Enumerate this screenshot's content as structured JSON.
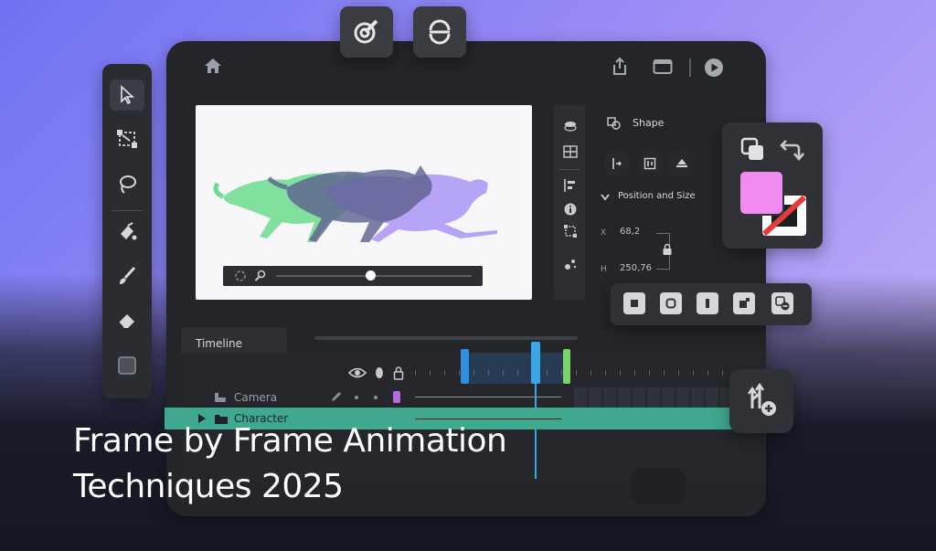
{
  "headline": {
    "line1": "Frame by Frame Animation",
    "line2": "Techniques 2025"
  },
  "icons": {
    "top_float_1": "target-pencil-icon",
    "top_float_2": "sync-icon",
    "home": "home-icon",
    "share": "share-icon",
    "window": "window-icon",
    "play": "play-icon",
    "tools": [
      "select-arrow-icon",
      "transform-icon",
      "lasso-icon",
      "paint-bucket-icon",
      "brush-icon",
      "eraser-icon",
      "color-swatch-icon"
    ]
  },
  "properties": {
    "section_title": "Shape",
    "subsection_title": "Position and Size",
    "x_label": "X",
    "x_value": "68,2",
    "y_label": "H",
    "y_value": "250,76"
  },
  "timeline": {
    "title": "Timeline",
    "layers": [
      {
        "name": "Camera"
      },
      {
        "name": "Character"
      }
    ]
  },
  "colors": {
    "accent_pink": "#f08cf0",
    "accent_blue": "#2e8fe0",
    "accent_green": "#7bd36a",
    "cat_green": "#68d88a",
    "cat_purple": "#a98cf2",
    "cat_dark": "#5b5f8e"
  },
  "playback": {
    "progress": 0.48
  }
}
